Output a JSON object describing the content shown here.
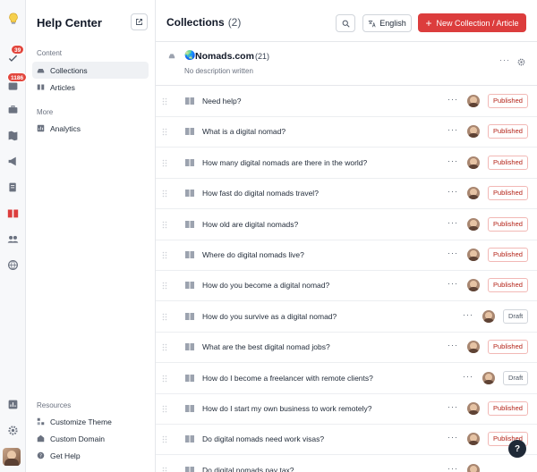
{
  "rail": {
    "badges": {
      "notifications": "39",
      "inbox": "1186"
    }
  },
  "sidebar": {
    "title": "Help Center",
    "section_content": "Content",
    "section_more": "More",
    "section_resources": "Resources",
    "items": {
      "collections": "Collections",
      "articles": "Articles",
      "analytics": "Analytics",
      "customize_theme": "Customize Theme",
      "custom_domain": "Custom Domain",
      "get_help": "Get Help"
    }
  },
  "header": {
    "title": "Collections",
    "count": "(2)",
    "language": "English",
    "new_button": "New Collection / Article"
  },
  "collection": {
    "name": "Nomads.com",
    "count": "(21)",
    "description": "No description written"
  },
  "articles": [
    {
      "title": "Need help?",
      "status": "Published"
    },
    {
      "title": "What is a digital nomad?",
      "status": "Published"
    },
    {
      "title": "How many digital nomads are there in the world?",
      "status": "Published"
    },
    {
      "title": "How fast do digital nomads travel?",
      "status": "Published"
    },
    {
      "title": "How old are digital nomads?",
      "status": "Published"
    },
    {
      "title": "Where do digital nomads live?",
      "status": "Published"
    },
    {
      "title": "How do you become a digital nomad?",
      "status": "Published"
    },
    {
      "title": "How do you survive as a digital nomad?",
      "status": "Draft"
    },
    {
      "title": "What are the best digital nomad jobs?",
      "status": "Published"
    },
    {
      "title": "How do I become a freelancer with remote clients?",
      "status": "Draft"
    },
    {
      "title": "How do I start my own business to work remotely?",
      "status": "Published"
    },
    {
      "title": "Do digital nomads need work visas?",
      "status": "Published"
    },
    {
      "title": "Do digital nomads pay tax?",
      "status": ""
    }
  ],
  "colors": {
    "accent": "#dc3d3d",
    "published": "#b42318",
    "draft": "#4b5563"
  }
}
